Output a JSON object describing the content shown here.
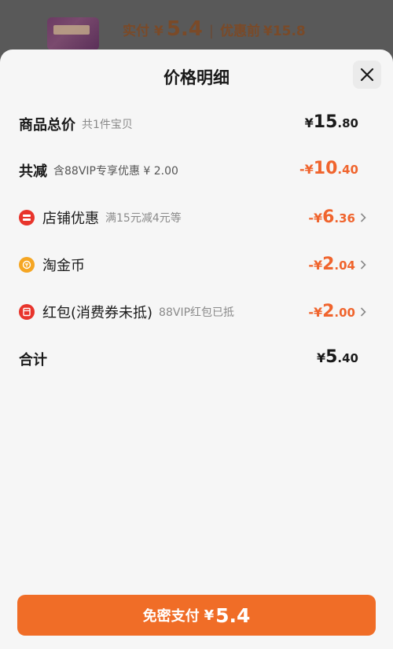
{
  "top_bar": {
    "paid_label": "实付",
    "yen": "¥",
    "paid_value": "5.4",
    "divider": "|",
    "before_label": "优惠前",
    "before_value": "¥15.8"
  },
  "sheet": {
    "title": "价格明细",
    "close_icon": "close-icon"
  },
  "rows": {
    "total": {
      "label": "商品总价",
      "sub": "共1件宝贝",
      "yen": "¥",
      "int": "15",
      "dec": ".80"
    },
    "reduction": {
      "label": "共减",
      "sub": "含88VIP专享优惠 ¥ 2.00",
      "yen": "-¥",
      "int": "10",
      "dec": ".40"
    },
    "shop": {
      "label": "店铺优惠",
      "sub": "满15元减4元等",
      "yen": "-¥",
      "int": "6",
      "dec": ".36",
      "icon": "shop-coupon-icon"
    },
    "coin": {
      "label": "淘金币",
      "sub": "",
      "yen": "-¥",
      "int": "2",
      "dec": ".04",
      "icon": "gold-coin-icon"
    },
    "redpacket": {
      "label": "红包(消费券未抵)",
      "sub": "88VIP红包已抵",
      "yen": "-¥",
      "int": "2",
      "dec": ".00",
      "icon": "red-packet-icon"
    },
    "sum": {
      "label": "合计",
      "yen": "¥",
      "int": "5",
      "dec": ".40"
    }
  },
  "pay_button": {
    "label": "免密支付",
    "yen": "¥",
    "value": "5.4"
  },
  "colors": {
    "accent": "#f0642d",
    "button": "#f06d27",
    "red_icon": "#e8342b",
    "coin_icon": "#f5a623"
  }
}
